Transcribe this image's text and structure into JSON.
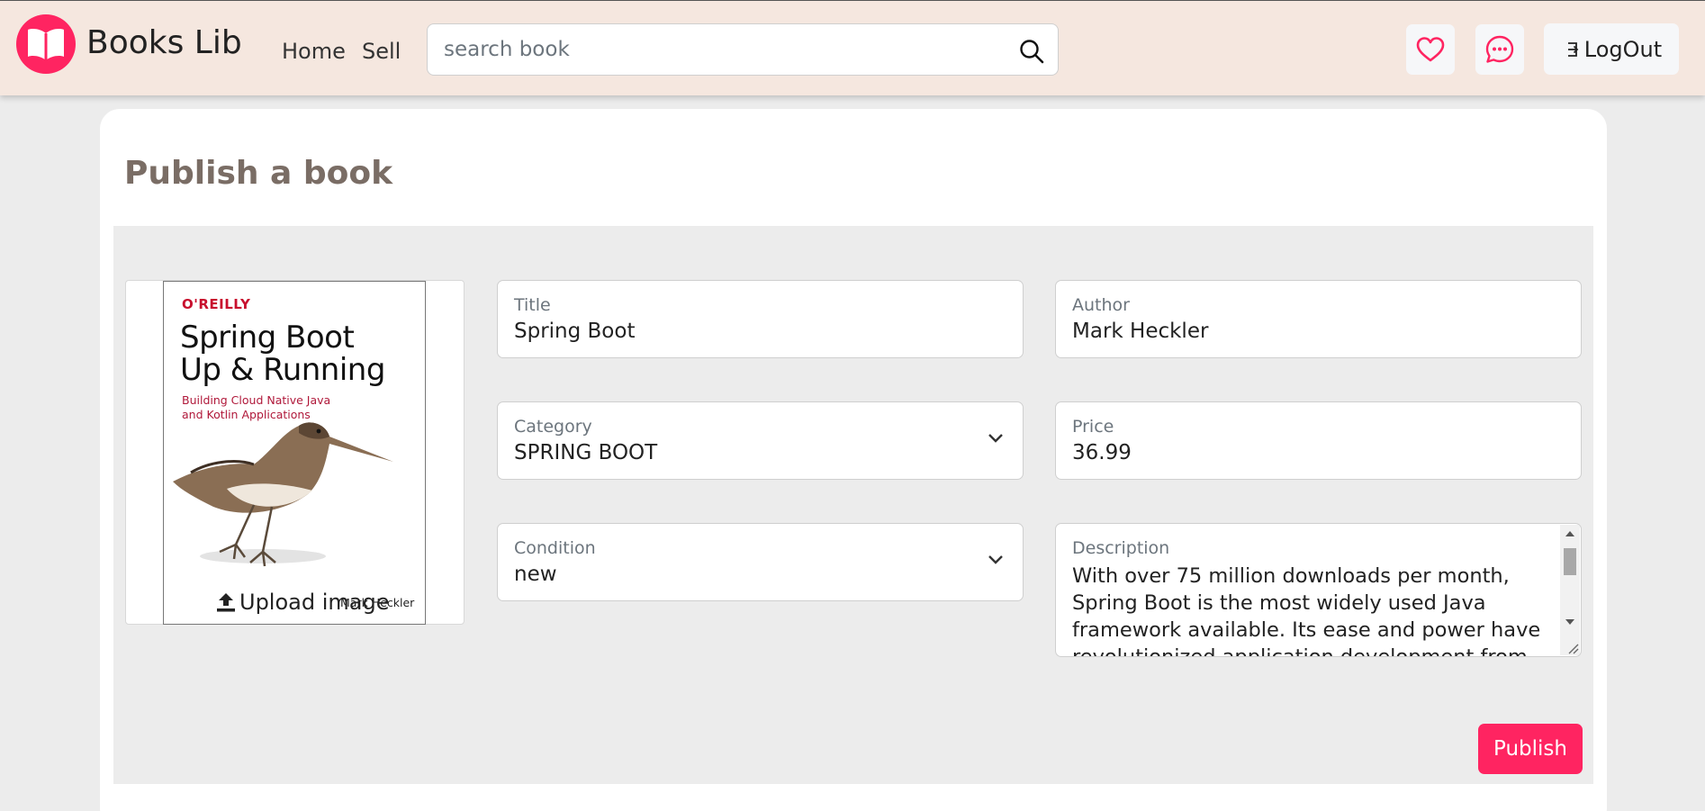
{
  "app": {
    "brand": "Books Lib",
    "logo_icon": "open-book-icon",
    "accent_color": "#ff2461"
  },
  "nav": {
    "links": [
      {
        "label": "Home"
      },
      {
        "label": "Sell"
      }
    ],
    "search": {
      "placeholder": "search book",
      "value": "",
      "icon": "search-icon"
    },
    "actions": {
      "wishlist_icon": "heart-icon",
      "messages_icon": "chat-bubble-icon",
      "logout_label": "LogOut",
      "logout_icon": "logout-icon"
    }
  },
  "page": {
    "title": "Publish a book"
  },
  "cover": {
    "publisher": "O'REILLY",
    "title_line1": "Spring Boot",
    "title_line2": "Up & Running",
    "subtitle_line1": "Building Cloud Native Java",
    "subtitle_line2": "and Kotlin Applications",
    "author": "Mark Heckler",
    "upload_label": "Upload image",
    "upload_icon": "upload-icon"
  },
  "form": {
    "title": {
      "label": "Title",
      "value": "Spring Boot"
    },
    "author": {
      "label": "Author",
      "value": "Mark Heckler"
    },
    "category": {
      "label": "Category",
      "value": "SPRING BOOT"
    },
    "price": {
      "label": "Price",
      "value": "36.99"
    },
    "condition": {
      "label": "Condition",
      "value": "new"
    },
    "description": {
      "label": "Description",
      "value": "With over 75 million downloads per month, Spring Boot is the most widely used Java framework available. Its ease and power have revolutionized application development from"
    },
    "publish_label": "Publish"
  }
}
